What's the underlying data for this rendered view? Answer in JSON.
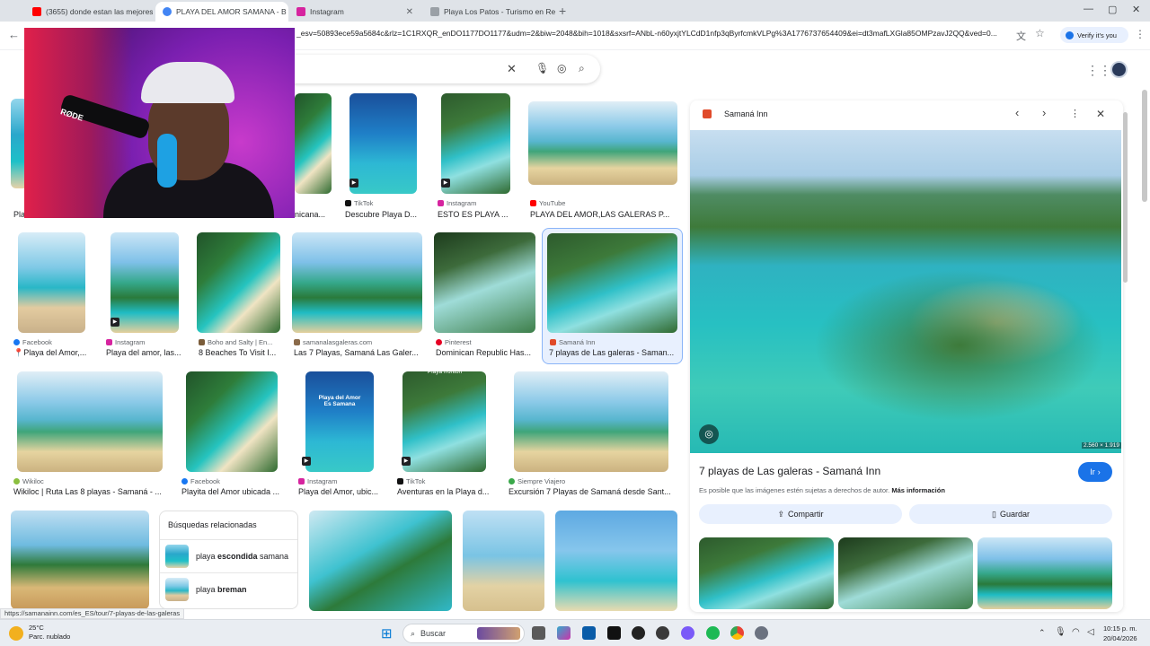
{
  "tabs": [
    {
      "title": "(3655) donde estan las mejores",
      "color": "#ff0000"
    },
    {
      "title": "PLAYA DEL AMOR SAMANA - B",
      "color": "#4285f4",
      "active": true
    },
    {
      "title": "Instagram",
      "color": "#d6249f"
    },
    {
      "title": "Playa Los Patos - Turismo en Re",
      "color": "#5f6368"
    }
  ],
  "address": {
    "url": "_esv=50893ece59a5684c&rlz=1C1RXQR_enDO1177DO1177&udm=2&biw=2048&bih=1018&sxsrf=ANbL-n60yxjtYLCdD1nfp3qByrfcmkVLPg%3A1776737654409&ei=dt3mafLXGla85OMPzavJ2QQ&ved=0...",
    "verify_label": "Verify it's you"
  },
  "results": [
    {
      "src": "",
      "title": "Pla"
    },
    {
      "src": "",
      "title": "nicana..."
    },
    {
      "src": "TikTok",
      "title": "Descubre Playa D..."
    },
    {
      "src": "Instagram",
      "title": "ESTO ES PLAYA ..."
    },
    {
      "src": "YouTube",
      "title": "PLAYA DEL AMOR,LAS GALERAS P..."
    },
    {
      "src": "Facebook",
      "title": "📍Playa del Amor,..."
    },
    {
      "src": "Instagram",
      "title": "Playa del amor, las..."
    },
    {
      "src": "Boho and Salty | En...",
      "title": "8 Beaches To Visit I..."
    },
    {
      "src": "samanalasgaleras.com",
      "title": "Las 7 Playas, Samaná Las Galer..."
    },
    {
      "src": "Pinterest",
      "title": "Dominican Republic Has..."
    },
    {
      "src": "Samaná Inn",
      "title": "7 playas de Las galeras - Saman..."
    },
    {
      "src": "Wikiloc",
      "title": "Wikiloc | Ruta Las 8 playas - Samaná - ..."
    },
    {
      "src": "Facebook",
      "title": "Playita del Amor ubicada ..."
    },
    {
      "src": "Instagram",
      "title": "Playa del Amor, ubic..."
    },
    {
      "src": "TikTok",
      "title": "Aventuras en la Playa d..."
    },
    {
      "src": "Siempre Viajero",
      "title": "Excursión 7 Playas de Samaná desde Sant..."
    }
  ],
  "overlay_texts": {
    "pin_caption": "Playa del Amor Es Samana",
    "tiktok_caption": "Playa frontón"
  },
  "related": {
    "heading": "Búsquedas relacionadas",
    "items": [
      {
        "prefix": "playa ",
        "bold": "escondida",
        "suffix": " samana"
      },
      {
        "prefix": "playa ",
        "bold": "breman",
        "suffix": ""
      }
    ]
  },
  "panel": {
    "source": "Samaná Inn",
    "resolution": "2.560 × 1.919",
    "title": "7 playas de Las galeras - Samaná Inn",
    "note": "Es posible que las imágenes estén sujetas a derechos de autor.",
    "more_info": "Más información",
    "go_label": "Ir",
    "share_label": "Compartir",
    "save_label": "Guardar"
  },
  "webcam": {
    "mic_brand": "RØDE"
  },
  "status_url": "https://samanainn.com/es_ES/tour/7-playas-de-las-galeras",
  "taskbar": {
    "weather_temp": "25°C",
    "weather_desc": "Parc. nublado",
    "search_label": "Buscar",
    "time": "10:15 p. m.",
    "date": "20/04/2026"
  },
  "colors": {
    "accent": "#1a73e8",
    "selection": "#e8f0fe"
  }
}
